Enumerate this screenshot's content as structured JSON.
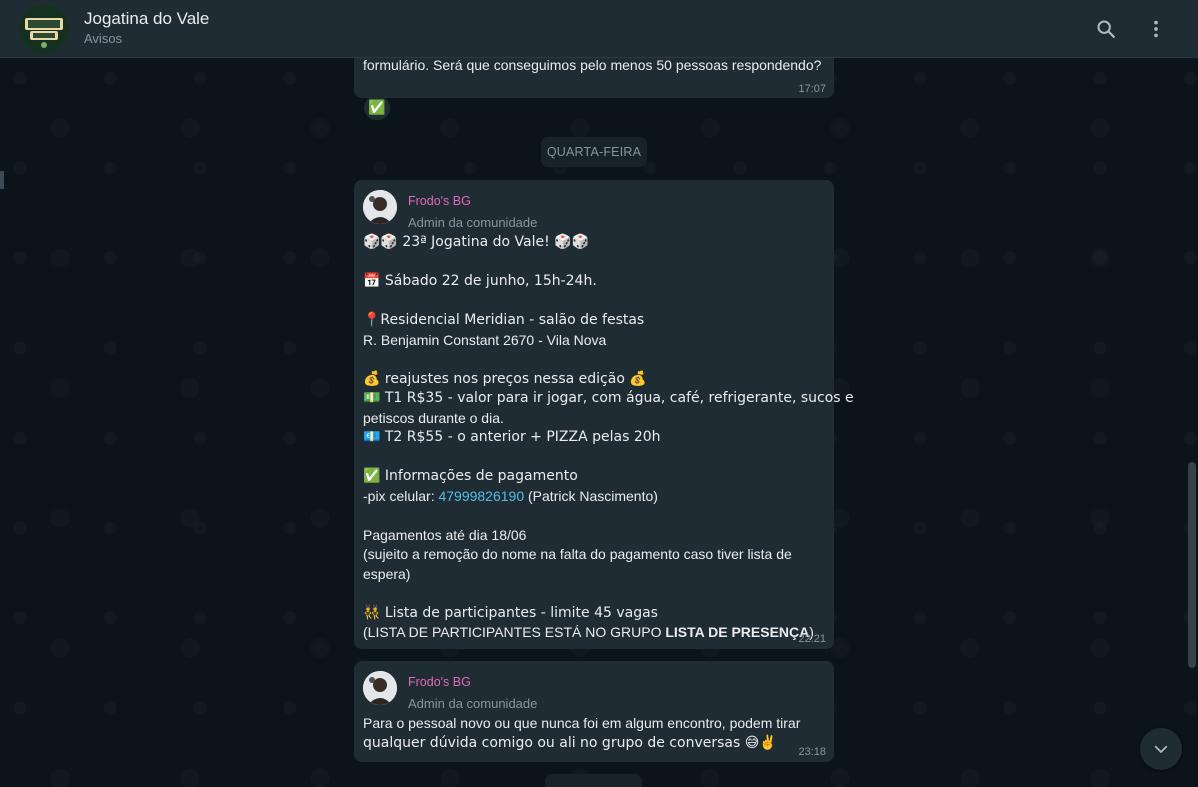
{
  "header": {
    "title": "Jogatina do Vale",
    "subtitle": "Avisos",
    "avatar_icon": "jogatina-logo",
    "search_icon": "search-icon",
    "menu_icon": "more-vertical-icon"
  },
  "messages": {
    "top": {
      "text": "formulário. Será que conseguimos pelo menos 50 pessoas respondendo?",
      "time": "17:07",
      "reaction": "✅"
    },
    "day_divider": "QUARTA-FEIRA",
    "announcement": {
      "sender": "Frodo's BG",
      "role": "Admin da comunidade",
      "l1": "🎲🎲 23ª Jogatina do Vale! 🎲🎲",
      "l2": "📅  Sábado 22 de junho, 15h-24h.",
      "l3": "📍Residencial Meridian - salão de festas",
      "l4": "R. Benjamin Constant 2670 - Vila Nova",
      "l5": "💰 reajustes nos preços nessa edição 💰",
      "l6": "💵 T1 R$35 - valor para ir jogar, com água, café, refrigerante, sucos e",
      "l7": "petiscos durante o dia.",
      "l8": "💶 T2 R$55 - o anterior + PIZZA pelas 20h",
      "l9": "✅ Informações de pagamento",
      "l10_prefix": "-pix celular: ",
      "l10_link": "47999826190",
      "l10_suffix": " (Patrick Nascimento)",
      "l11": "Pagamentos até dia 18/06",
      "l12": "(sujeito a remoção do nome na falta do pagamento caso tiver lista de",
      "l13": "espera)",
      "l14": "👯 Lista de participantes - limite 45 vagas",
      "l15_prefix": "(LISTA DE PARTICIPANTES ESTÁ NO GRUPO ",
      "l15_bold": "LISTA DE PRESENÇA",
      "l15_suffix": ")",
      "time": "22:21"
    },
    "followup": {
      "sender": "Frodo's BG",
      "role": "Admin da comunidade",
      "l1": "Para o pessoal novo ou que nunca foi em algum encontro, podem tirar",
      "l2": "qualquer dúvida comigo ou ali no grupo de conversas 😅✌️",
      "time": "23:18"
    }
  },
  "colors": {
    "header_bg": "#202c33",
    "chat_bg": "#0b141a",
    "bubble_bg": "#202c33",
    "sender_name": "#e26ab6",
    "link": "#53bdeb",
    "muted": "#8696a0"
  }
}
